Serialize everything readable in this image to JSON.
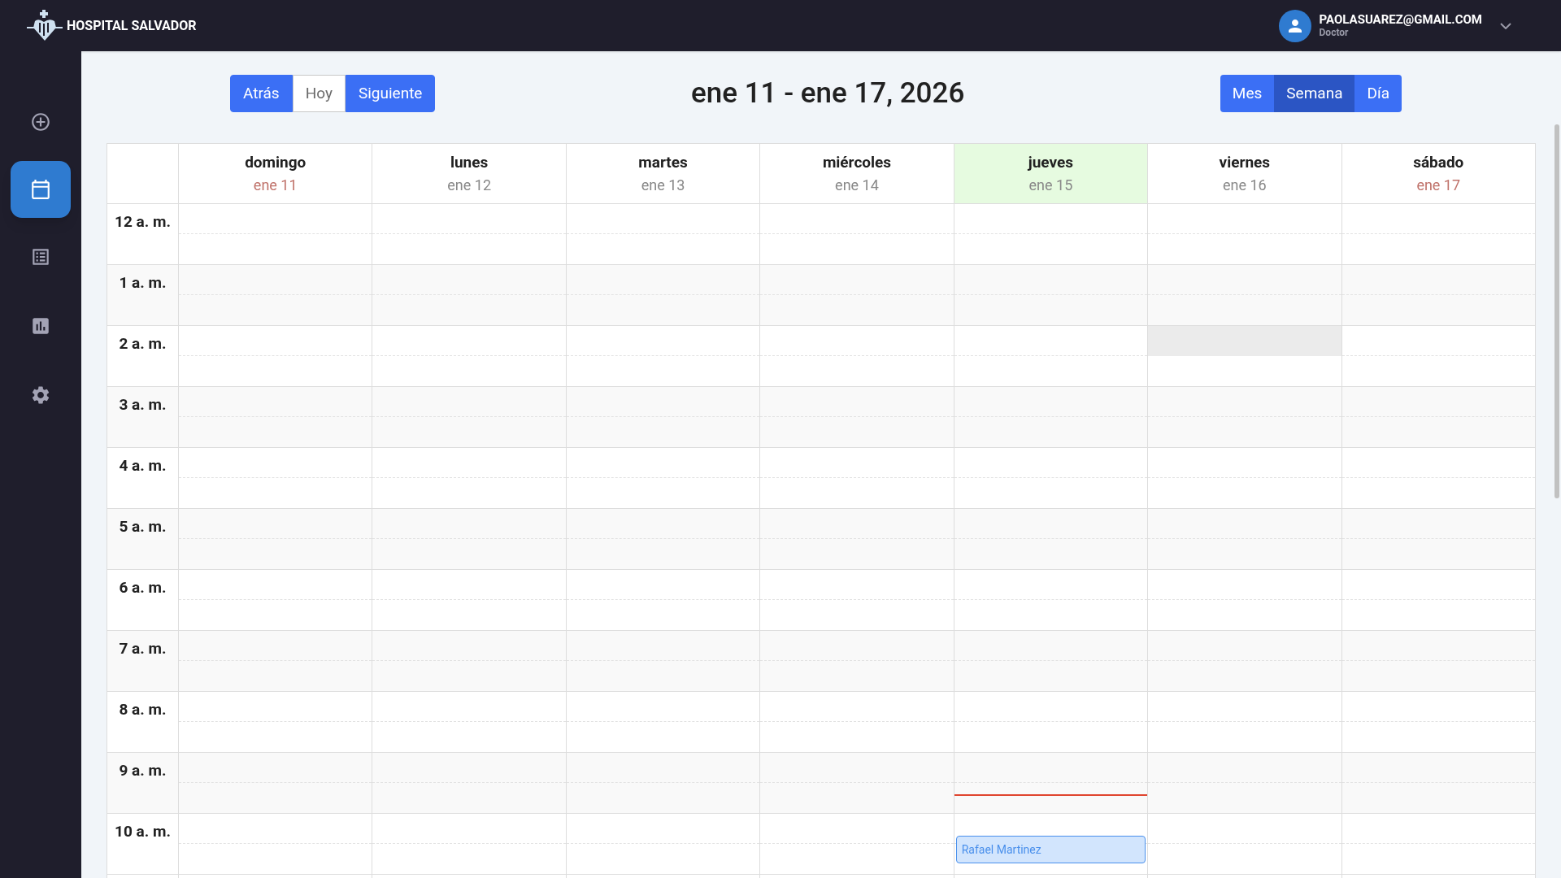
{
  "header": {
    "brand": "HOSPITAL SALVADOR",
    "user": {
      "email": "PAOLASUAREZ@GMAIL.COM",
      "role": "Doctor",
      "menu_expanded": false
    }
  },
  "sidebar": {
    "items": [
      {
        "kind": "add",
        "selected": false
      },
      {
        "kind": "calendar",
        "selected": true
      },
      {
        "kind": "list",
        "selected": false
      },
      {
        "kind": "chart",
        "selected": false
      },
      {
        "kind": "settings",
        "selected": false
      }
    ]
  },
  "toolbar": {
    "nav_buttons": [
      {
        "label": "Atrás",
        "kind": "primary"
      },
      {
        "label": "Hoy",
        "kind": "outline"
      },
      {
        "label": "Siguiente",
        "kind": "primary"
      }
    ],
    "title": "ene 11 - ene 17, 2026",
    "views": [
      {
        "label": "Mes",
        "selected": false
      },
      {
        "label": "Semana",
        "selected": true
      },
      {
        "label": "Día",
        "selected": false
      }
    ]
  },
  "calendar": {
    "days": [
      {
        "name": "domingo",
        "date": "ene 11",
        "weekend": true,
        "today": false
      },
      {
        "name": "lunes",
        "date": "ene 12",
        "weekend": false,
        "today": false
      },
      {
        "name": "martes",
        "date": "ene 13",
        "weekend": false,
        "today": false
      },
      {
        "name": "miércoles",
        "date": "ene 14",
        "weekend": false,
        "today": false
      },
      {
        "name": "jueves",
        "date": "ene 15",
        "weekend": false,
        "today": true,
        "now_line": true,
        "events": [
          {
            "title": "Rafael Martinez"
          }
        ]
      },
      {
        "name": "viernes",
        "date": "ene 16",
        "weekend": false,
        "today": false,
        "blocked_slot": true
      },
      {
        "name": "sábado",
        "date": "ene 17",
        "weekend": true,
        "today": false
      }
    ],
    "hours": [
      "12 a. m.",
      "1 a. m.",
      "2 a. m.",
      "3 a. m.",
      "4 a. m.",
      "5 a. m.",
      "6 a. m.",
      "7 a. m.",
      "8 a. m.",
      "9 a. m.",
      "10 a. m."
    ]
  }
}
